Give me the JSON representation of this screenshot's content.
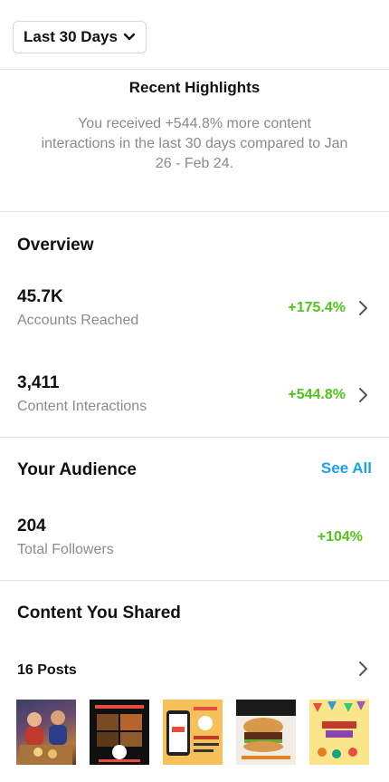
{
  "filter": {
    "label": "Last 30 Days"
  },
  "highlights": {
    "title": "Recent Highlights",
    "text": "You received +544.8% more content interactions in the last 30 days compared to Jan 26 - Feb 24."
  },
  "overview": {
    "title": "Overview",
    "items": [
      {
        "value": "45.7K",
        "label": "Accounts Reached",
        "change": "+175.4%"
      },
      {
        "value": "3,411",
        "label": "Content Interactions",
        "change": "+544.8%"
      }
    ]
  },
  "audience": {
    "title": "Your Audience",
    "see_all": "See All",
    "value": "204",
    "label": "Total Followers",
    "change": "+104%"
  },
  "content": {
    "title": "Content You Shared",
    "posts_label": "16 Posts"
  },
  "colors": {
    "positive": "#52c41a",
    "link": "#1aa0f0",
    "muted": "#8a8a8a"
  }
}
